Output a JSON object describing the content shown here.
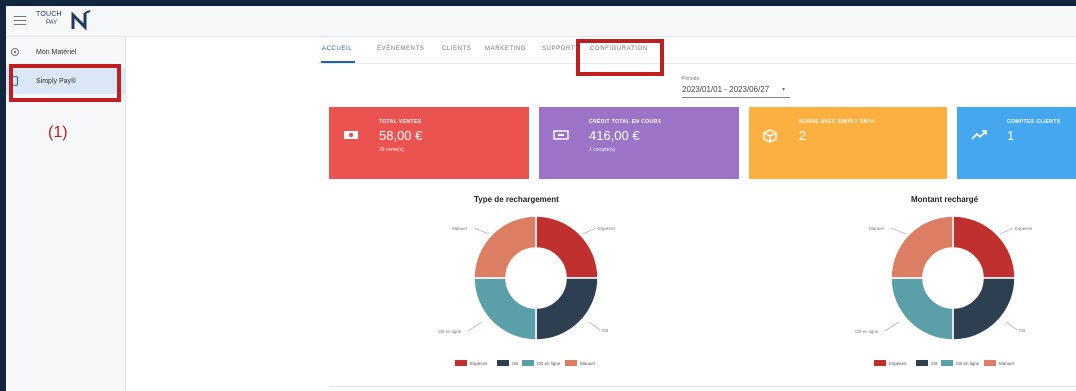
{
  "logo": {
    "line1": "TOUCH",
    "line2": "PAY"
  },
  "sidebar": {
    "items": [
      {
        "label": "Mon Matériel"
      },
      {
        "label": "Simply Pay®"
      }
    ]
  },
  "annotation": {
    "label": "(1)"
  },
  "tabs": [
    "ACCUEIL",
    "ÉVÉNEMENTS",
    "CLIENTS",
    "MARKETING",
    "SUPPORT",
    "CONFIGURATION"
  ],
  "period": {
    "label": "Période",
    "value": "2023/01/01 - 2023/06/27",
    "caret": "▾"
  },
  "cards": [
    {
      "title": "TOTAL VENTES",
      "value": "58,00 €",
      "sub": "29 vente(s)",
      "color": "#ea5350",
      "icon": "cash-icon"
    },
    {
      "title": "CRÉDIT TOTAL EN COURS",
      "value": "416,00 €",
      "sub": "1 compte(s)",
      "color": "#9b73c7",
      "icon": "wallet-icon"
    },
    {
      "title": "BORNE AVEC SIMPLY PAY®",
      "value": "2",
      "sub": "",
      "color": "#fbb040",
      "icon": "cube-icon"
    },
    {
      "title": "COMPTES CLIENTS",
      "value": "1",
      "sub": "",
      "color": "#45a7ef",
      "icon": "trend-up-icon"
    }
  ],
  "charts": [
    {
      "title": "Type de rechargement",
      "slice_labels": {
        "especes": "Espèces",
        "cb": "CB",
        "cb_ligne": "CB en ligne",
        "manuel": "Manuel"
      }
    },
    {
      "title": "Montant rechargé",
      "slice_labels": {
        "especes": "Espèces",
        "cb": "CB",
        "cb_ligne": "CB en ligne",
        "manuel": "Manuel"
      }
    }
  ],
  "legend": [
    {
      "label": "Espèces",
      "color": "#c0302e"
    },
    {
      "label": "CB",
      "color": "#2e3f51"
    },
    {
      "label": "CB en ligne",
      "color": "#5b9fa8"
    },
    {
      "label": "Manuel",
      "color": "#dc7e63"
    }
  ],
  "highlight_color": "#c01f1f"
}
